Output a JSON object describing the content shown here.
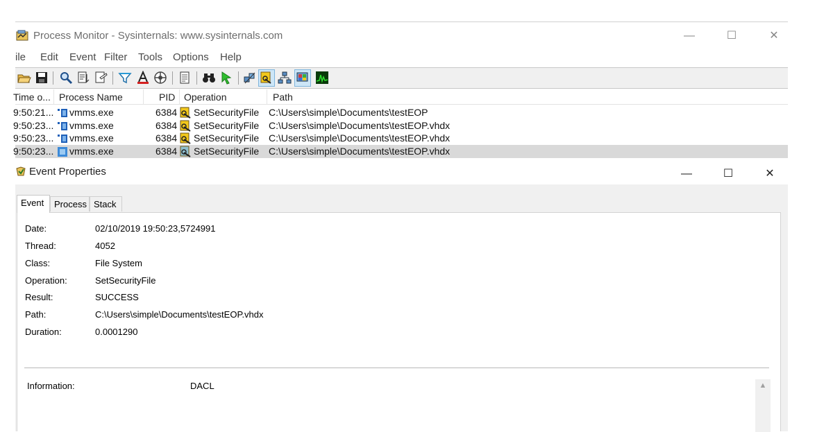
{
  "procmon": {
    "title": "Process Monitor - Sysinternals: www.sysinternals.com",
    "menu": [
      "File",
      "Edit",
      "Event",
      "Filter",
      "Tools",
      "Options",
      "Help"
    ],
    "menu_display": [
      "ile",
      "Edit",
      "Event",
      "Filter",
      "Tools",
      "Options",
      "Help"
    ],
    "columns": {
      "time": "Time o...",
      "process": "Process Name",
      "pid": "PID",
      "operation": "Operation",
      "path": "Path"
    },
    "rows": [
      {
        "time": "9:50:21...",
        "process": "vmms.exe",
        "pid": "6384",
        "operation": "SetSecurityFile",
        "path": "C:\\Users\\simple\\Documents\\testEOP",
        "selected": false
      },
      {
        "time": "9:50:23...",
        "process": "vmms.exe",
        "pid": "6384",
        "operation": "SetSecurityFile",
        "path": "C:\\Users\\simple\\Documents\\testEOP.vhdx",
        "selected": false
      },
      {
        "time": "9:50:23...",
        "process": "vmms.exe",
        "pid": "6384",
        "operation": "SetSecurityFile",
        "path": "C:\\Users\\simple\\Documents\\testEOP.vhdx",
        "selected": false
      },
      {
        "time": "9:50:23...",
        "process": "vmms.exe",
        "pid": "6384",
        "operation": "SetSecurityFile",
        "path": "C:\\Users\\simple\\Documents\\testEOP.vhdx",
        "selected": true
      }
    ],
    "toolbar_icons": [
      "open-icon",
      "save-icon",
      "find-icon",
      "autoscroll-icon",
      "clear-icon",
      "filter-icon",
      "highlight-icon",
      "include-process-icon",
      "jump-icon",
      "find-binoculars-icon",
      "jump-to-icon",
      "registry-activity-icon",
      "file-activity-icon",
      "network-activity-icon",
      "process-activity-icon",
      "profiling-icon"
    ]
  },
  "event_properties": {
    "title": "Event Properties",
    "tabs": [
      "Event",
      "Process",
      "Stack"
    ],
    "active_tab": "Event",
    "fields": [
      {
        "label": "Date:",
        "value": "02/10/2019 19:50:23,5724991"
      },
      {
        "label": "Thread:",
        "value": "4052"
      },
      {
        "label": "Class:",
        "value": "File System"
      },
      {
        "label": "Operation:",
        "value": "SetSecurityFile"
      },
      {
        "label": "Result:",
        "value": "SUCCESS"
      },
      {
        "label": "Path:",
        "value": "C:\\Users\\simple\\Documents\\testEOP.vhdx"
      },
      {
        "label": "Duration:",
        "value": "0.0001290"
      }
    ],
    "information": {
      "label": "Information:",
      "value": "DACL"
    }
  },
  "window_controls": {
    "minimize": "—",
    "maximize": "☐",
    "close": "✕"
  },
  "colors": {
    "selection": "#d9d9d9",
    "toolbar_bg": "#f0f0f0",
    "accent_blue": "#1e6fd9",
    "icon_yellow": "#f2c81b",
    "icon_green": "#2fbf2f"
  }
}
